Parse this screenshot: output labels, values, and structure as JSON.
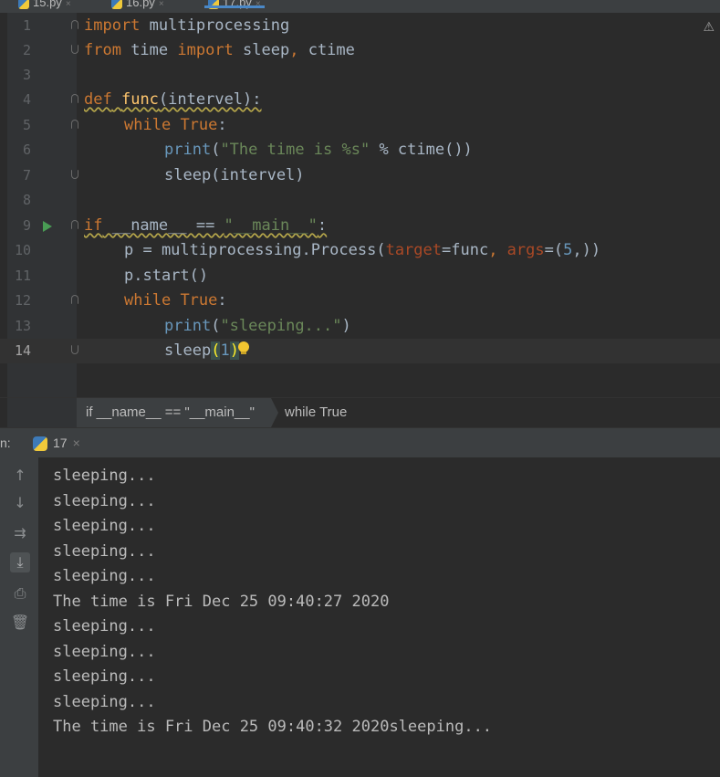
{
  "tabs": [
    {
      "label": "15.py",
      "close": "×"
    },
    {
      "label": "16.py",
      "close": "×"
    },
    {
      "label": "17.py",
      "close": "×"
    }
  ],
  "editor": {
    "lines": [
      "1",
      "2",
      "3",
      "4",
      "5",
      "6",
      "7",
      "8",
      "9",
      "10",
      "11",
      "12",
      "13",
      "14"
    ],
    "code": {
      "l1": {
        "kw": "import",
        "rest": " multiprocessing"
      },
      "l2": {
        "kw1": "from",
        "mid": " time ",
        "kw2": "import",
        "rest": " sleep",
        "comma": ",",
        "rest2": " ctime"
      },
      "l4": {
        "kw": "def",
        "name": "func",
        "rest": "(intervel):"
      },
      "l5": {
        "kw": "while",
        "sp": " ",
        "val": "True",
        "colon": ":"
      },
      "l6": {
        "fn": "print",
        "open": "(",
        "str": "\"The time is %s\"",
        "rest": " % ctime())"
      },
      "l7": {
        "text": "sleep(intervel)"
      },
      "l9": {
        "kw": "if",
        "pre": " __name__ == ",
        "str": "\"__main__\"",
        "colon": ":"
      },
      "l10": {
        "pre": "p = multiprocessing.Process(",
        "p1": "target",
        "eq1": "=func",
        "comma": ", ",
        "p2": "args",
        "eq2": "=(",
        "num": "5",
        "rest": ",))"
      },
      "l11": {
        "text": "p.start()"
      },
      "l12": {
        "kw": "while",
        "sp": " ",
        "val": "True",
        "colon": ":"
      },
      "l13": {
        "fn": "print",
        "open": "(",
        "str": "\"sleeping...\"",
        "close": ")"
      },
      "l14": {
        "pre": "sleep",
        "open": "(",
        "num": "1",
        "close": ")"
      }
    }
  },
  "breadcrumb": {
    "item1": "if __name__ == \"__main__\"",
    "item2": "while True"
  },
  "run": {
    "label": "n:",
    "tab": "17",
    "close": "×"
  },
  "console": {
    "output": [
      "sleeping...",
      "sleeping...",
      "sleeping...",
      "sleeping...",
      "sleeping...",
      "The time is Fri Dec 25 09:40:27 2020",
      "sleeping...",
      "sleeping...",
      "sleeping...",
      "sleeping...",
      "The time is Fri Dec 25 09:40:32 2020sleeping..."
    ]
  },
  "icons": {
    "warning": "⚠",
    "up": "↑",
    "down": "↓",
    "wrap": "⇉",
    "scroll_end": "⤓",
    "print": "⎙",
    "trash": "🗑"
  }
}
